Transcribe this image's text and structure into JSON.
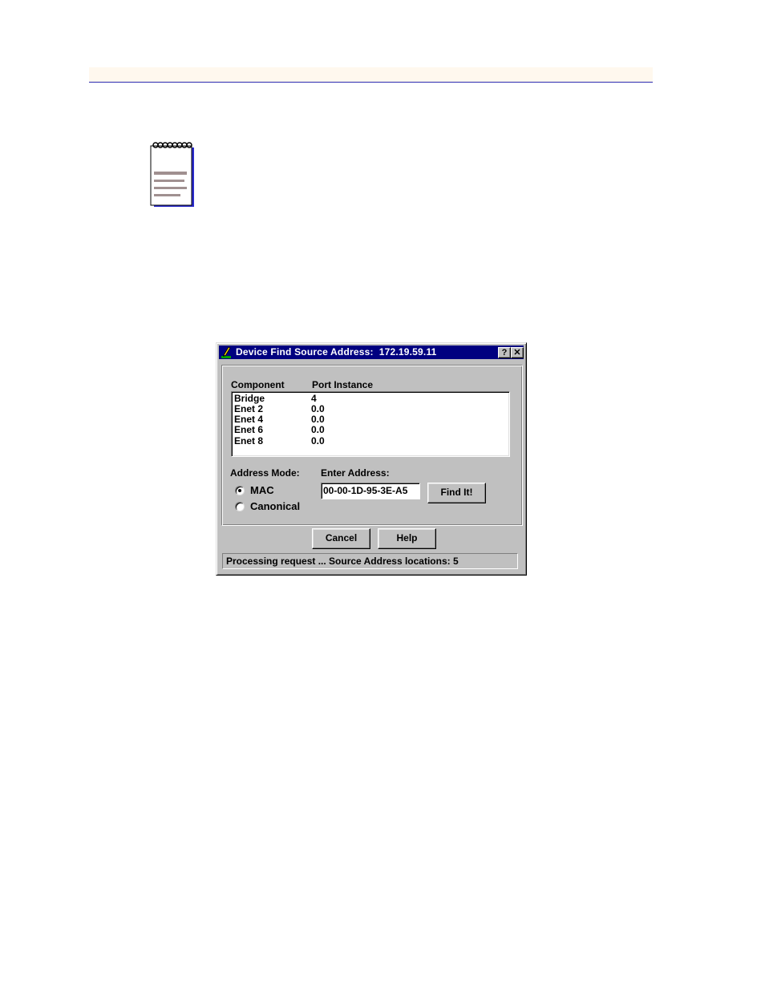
{
  "dialog": {
    "title": "Device Find Source Address:  172.19.59.11",
    "help_button": "?",
    "close_button": "✕"
  },
  "table": {
    "headers": [
      "Component",
      "Port Instance"
    ],
    "rows": [
      [
        "Bridge",
        "4"
      ],
      [
        "Enet 2",
        "0.0"
      ],
      [
        "Enet 4",
        "0.0"
      ],
      [
        "Enet 6",
        "0.0"
      ],
      [
        "Enet 8",
        "0.0"
      ]
    ]
  },
  "address_mode": {
    "label": "Address Mode:",
    "options": [
      "MAC",
      "Canonical"
    ],
    "selected": "MAC"
  },
  "enter_address": {
    "label": "Enter Address:",
    "value": "00-00-1D-95-3E-A5"
  },
  "buttons": {
    "find": "Find It!",
    "cancel": "Cancel",
    "help": "Help"
  },
  "status": "Processing request ... Source Address locations: 5",
  "icons": {
    "note": "notepad-icon",
    "app": "pencil-app-icon"
  }
}
